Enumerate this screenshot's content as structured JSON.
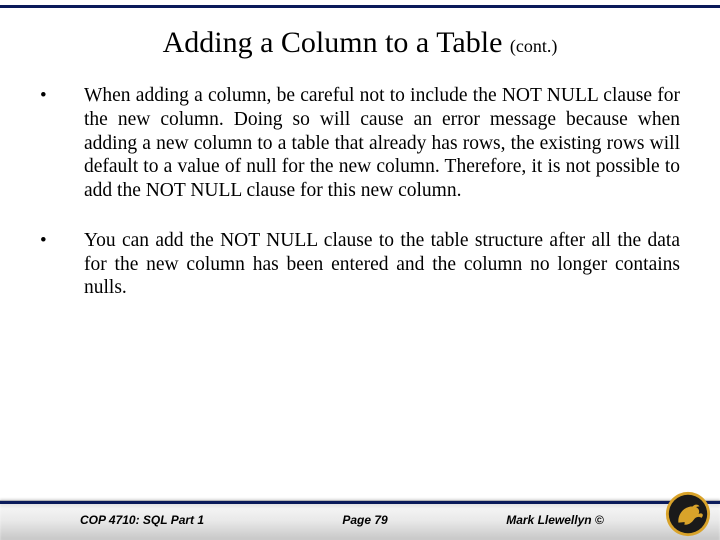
{
  "title_main": "Adding a Column to a Table ",
  "title_cont": "(cont.)",
  "bullets": [
    "When adding a column, be careful not to include the NOT NULL clause for the new column.  Doing so will cause an error message because when adding a new column to a table that already has rows, the existing rows will default to a value of null for the new column.  Therefore, it is not possible to add the NOT NULL clause for this new column.",
    "You can add the NOT NULL clause to the table structure after all the data for the new column has been entered and the column no longer contains nulls."
  ],
  "footer": {
    "course": "COP 4710: SQL Part 1",
    "page": "Page 79",
    "author": "Mark Llewellyn ©"
  },
  "colors": {
    "rule": "#0a1a5a",
    "logo_gold": "#d9a32a",
    "logo_dark": "#1a1a1a"
  }
}
